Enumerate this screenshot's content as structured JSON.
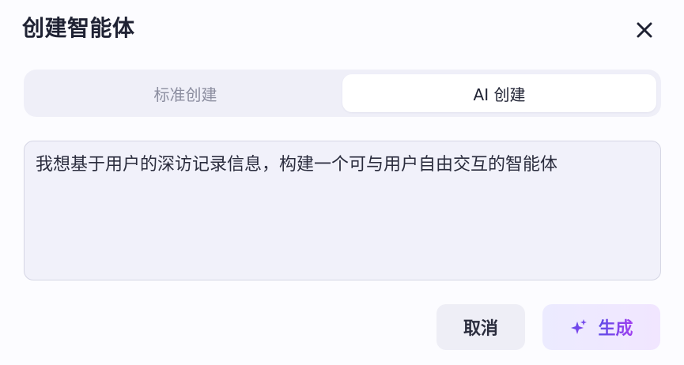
{
  "dialog": {
    "title": "创建智能体",
    "close_icon": "close-icon"
  },
  "tabs": [
    {
      "label": "标准创建",
      "active": false
    },
    {
      "label": "AI 创建",
      "active": true
    }
  ],
  "prompt": {
    "value": "我想基于用户的深访记录信息，构建一个可与用户自由交互的智能体"
  },
  "actions": {
    "cancel_label": "取消",
    "generate_label": "生成",
    "generate_icon": "sparkle-icon"
  },
  "colors": {
    "accent": "#6a42e6",
    "accent_end": "#a23ff0",
    "tab_track": "#efeff8",
    "input_bg": "#f1f1fa"
  }
}
